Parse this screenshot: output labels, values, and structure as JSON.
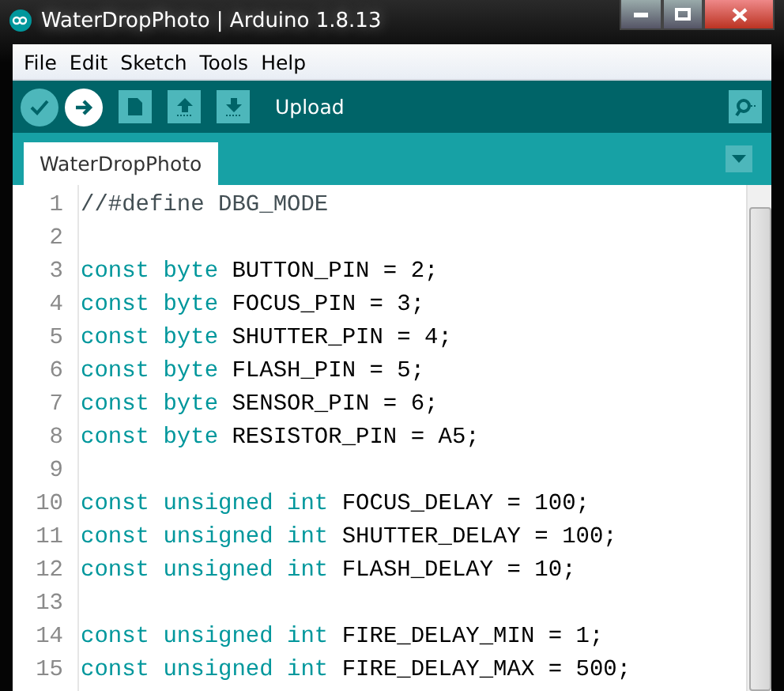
{
  "window": {
    "title": "WaterDropPhoto | Arduino 1.8.13"
  },
  "menu": [
    "File",
    "Edit",
    "Sketch",
    "Tools",
    "Help"
  ],
  "toolbar": {
    "buttons": [
      {
        "kind": "verify",
        "selected": false
      },
      {
        "kind": "upload",
        "selected": true
      },
      {
        "kind": "new",
        "selected": false
      },
      {
        "kind": "open",
        "selected": false
      },
      {
        "kind": "save",
        "selected": false
      }
    ],
    "hint": "Upload"
  },
  "tabs": [
    {
      "label": "WaterDropPhoto",
      "selected": true
    }
  ],
  "editor": {
    "lines": [
      {
        "number": "1",
        "tokens": [
          {
            "kind": "comment",
            "text": "//#define DBG_MODE"
          }
        ]
      },
      {
        "number": "2"
      },
      {
        "number": "3",
        "tokens": [
          {
            "kind": "keyword",
            "text": "const byte"
          },
          {
            "kind": "plain",
            "text": " BUTTON_PIN = 2;"
          }
        ]
      },
      {
        "number": "4",
        "tokens": [
          {
            "kind": "keyword",
            "text": "const byte"
          },
          {
            "kind": "plain",
            "text": " FOCUS_PIN = 3;"
          }
        ]
      },
      {
        "number": "5",
        "tokens": [
          {
            "kind": "keyword",
            "text": "const byte"
          },
          {
            "kind": "plain",
            "text": " SHUTTER_PIN = 4;"
          }
        ]
      },
      {
        "number": "6",
        "tokens": [
          {
            "kind": "keyword",
            "text": "const byte"
          },
          {
            "kind": "plain",
            "text": " FLASH_PIN = 5;"
          }
        ]
      },
      {
        "number": "7",
        "tokens": [
          {
            "kind": "keyword",
            "text": "const byte"
          },
          {
            "kind": "plain",
            "text": " SENSOR_PIN = 6;"
          }
        ]
      },
      {
        "number": "8",
        "tokens": [
          {
            "kind": "keyword",
            "text": "const byte"
          },
          {
            "kind": "plain",
            "text": " RESISTOR_PIN = A5;"
          }
        ]
      },
      {
        "number": "9"
      },
      {
        "number": "10",
        "tokens": [
          {
            "kind": "keyword",
            "text": "const unsigned int"
          },
          {
            "kind": "plain",
            "text": " FOCUS_DELAY = 100;"
          }
        ]
      },
      {
        "number": "11",
        "tokens": [
          {
            "kind": "keyword",
            "text": "const unsigned int"
          },
          {
            "kind": "plain",
            "text": " SHUTTER_DELAY = 100;"
          }
        ]
      },
      {
        "number": "12",
        "tokens": [
          {
            "kind": "keyword",
            "text": "const unsigned int"
          },
          {
            "kind": "plain",
            "text": " FLASH_DELAY = 10;"
          }
        ]
      },
      {
        "number": "13"
      },
      {
        "number": "14",
        "tokens": [
          {
            "kind": "keyword",
            "text": "const unsigned int"
          },
          {
            "kind": "plain",
            "text": " FIRE_DELAY_MIN = 1;"
          }
        ]
      },
      {
        "number": "15",
        "tokens": [
          {
            "kind": "keyword",
            "text": "const unsigned int"
          },
          {
            "kind": "plain",
            "text": " FIRE_DELAY_MAX = 500;"
          }
        ]
      }
    ]
  }
}
